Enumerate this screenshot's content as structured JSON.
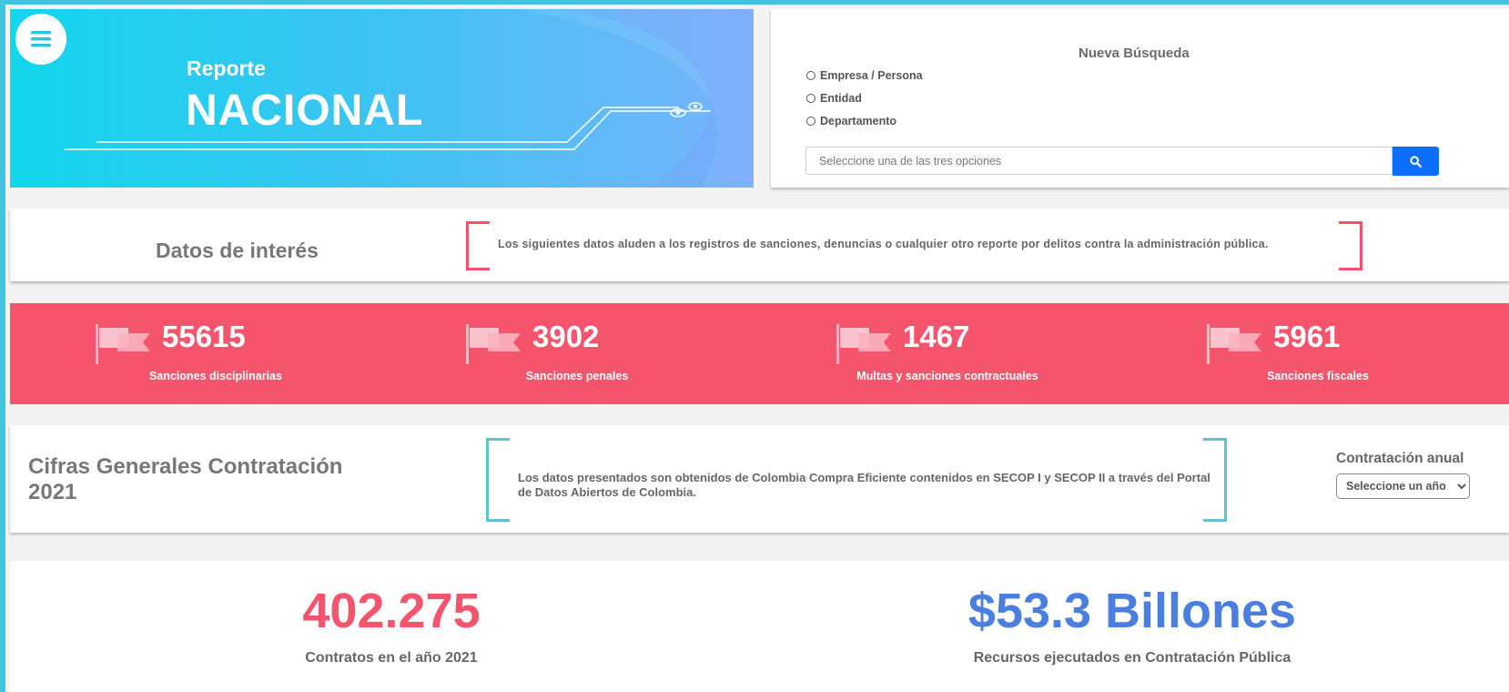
{
  "banner": {
    "subtitle": "Reporte",
    "title": "NACIONAL"
  },
  "search": {
    "title": "Nueva Búsqueda",
    "options": [
      "Empresa / Persona",
      "Entidad",
      "Departamento"
    ],
    "placeholder": "Seleccione una de las tres opciones"
  },
  "interest": {
    "title": "Datos de interés",
    "text": "Los siguientes datos aluden a los registros de sanciones, denuncias o cualquier otro reporte por delitos contra la administración pública."
  },
  "stats": [
    {
      "value": "55615",
      "label": "Sanciones disciplinarias"
    },
    {
      "value": "3902",
      "label": "Sanciones penales"
    },
    {
      "value": "1467",
      "label": "Multas y sanciones contractuales"
    },
    {
      "value": "5961",
      "label": "Sanciones fiscales"
    }
  ],
  "cifras": {
    "title": "Cifras Generales Contratación 2021",
    "text": "Los datos presentados son obtenidos de Colombia Compra Eficiente contenidos en SECOP I y SECOP II a través del Portal de Datos Abiertos de Colombia.",
    "annual_label": "Contratación anual",
    "select_value": "Seleccione un año"
  },
  "totals": {
    "contracts_value": "402.275",
    "contracts_label": "Contratos en el año 2021",
    "resources_value": "$53.3 Billones",
    "resources_label": "Recursos ejecutados en Contratación Pública"
  },
  "colors": {
    "accent_red": "#f4546c",
    "accent_blue": "#4a7fe0",
    "accent_teal": "#5fc2d0",
    "button_blue": "#0d6efd"
  },
  "icons": {
    "menu": "hamburger-icon",
    "search": "search-icon",
    "stat": "flag-icon"
  }
}
